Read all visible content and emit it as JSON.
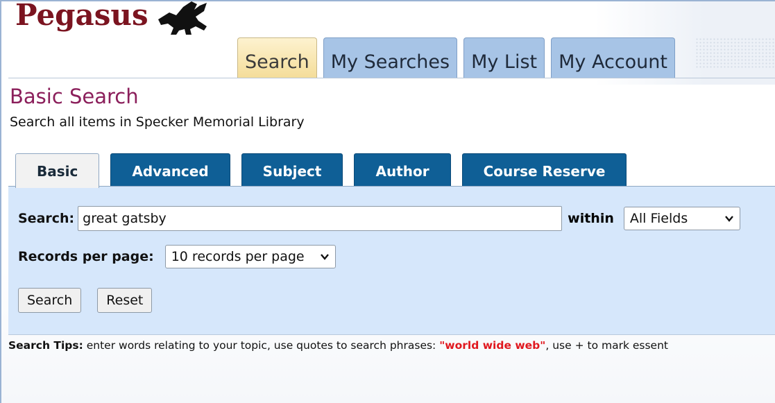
{
  "logo": {
    "text": "Pegasus"
  },
  "topnav": [
    {
      "label": "Search",
      "active": true
    },
    {
      "label": "My Searches",
      "active": false
    },
    {
      "label": "My List",
      "active": false
    },
    {
      "label": "My Account",
      "active": false
    }
  ],
  "page": {
    "title": "Basic Search",
    "subtitle": "Search all items in Specker Memorial Library"
  },
  "search_tabs": [
    {
      "label": "Basic",
      "active": true
    },
    {
      "label": "Advanced",
      "active": false
    },
    {
      "label": "Subject",
      "active": false
    },
    {
      "label": "Author",
      "active": false
    },
    {
      "label": "Course Reserve",
      "active": false
    }
  ],
  "form": {
    "search_label": "Search:",
    "search_value": "great gatsby",
    "within_label": "within",
    "within_value": "All Fields",
    "records_label": "Records per page:",
    "records_value": "10 records per page",
    "search_button": "Search",
    "reset_button": "Reset"
  },
  "tips": {
    "label": "Search Tips:",
    "text_before": " enter words relating to your topic, use quotes to search phrases: ",
    "phrase": "\"world wide web\"",
    "text_after": ", use + to mark essent"
  },
  "colors": {
    "logo": "#7b1420",
    "title": "#8b1f5b",
    "tab_blue": "#0f5f96",
    "panel": "#d6e7fb",
    "phrase": "#e0181f"
  }
}
